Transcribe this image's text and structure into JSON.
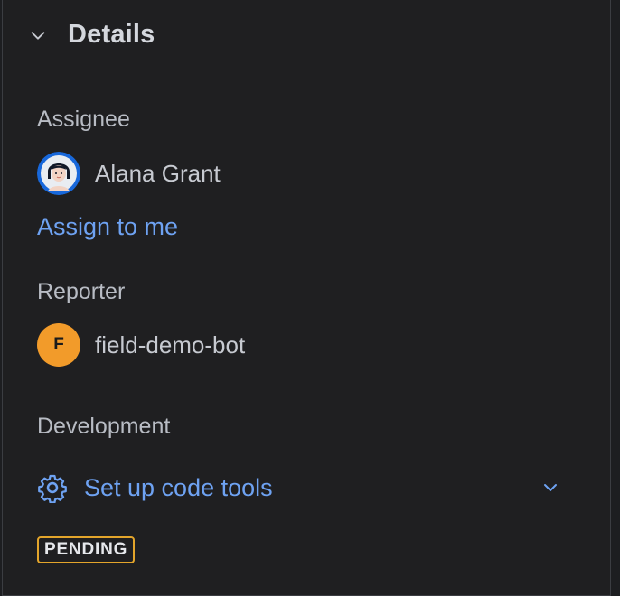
{
  "details": {
    "title": "Details",
    "assignee": {
      "label": "Assignee",
      "name": "Alana Grant",
      "assign_to_me": "Assign to me"
    },
    "reporter": {
      "label": "Reporter",
      "avatar_letter": "F",
      "name": "field-demo-bot"
    },
    "development": {
      "label": "Development",
      "setup_label": "Set up code tools",
      "status_badge": "PENDING"
    }
  },
  "colors": {
    "link": "#6ea2f2",
    "reporter_avatar": "#f29b2a",
    "badge_border": "#e3a52b"
  },
  "icons": {
    "collapse": "chevron-down-icon",
    "development": "gear-icon",
    "dropdown": "chevron-down-icon"
  }
}
